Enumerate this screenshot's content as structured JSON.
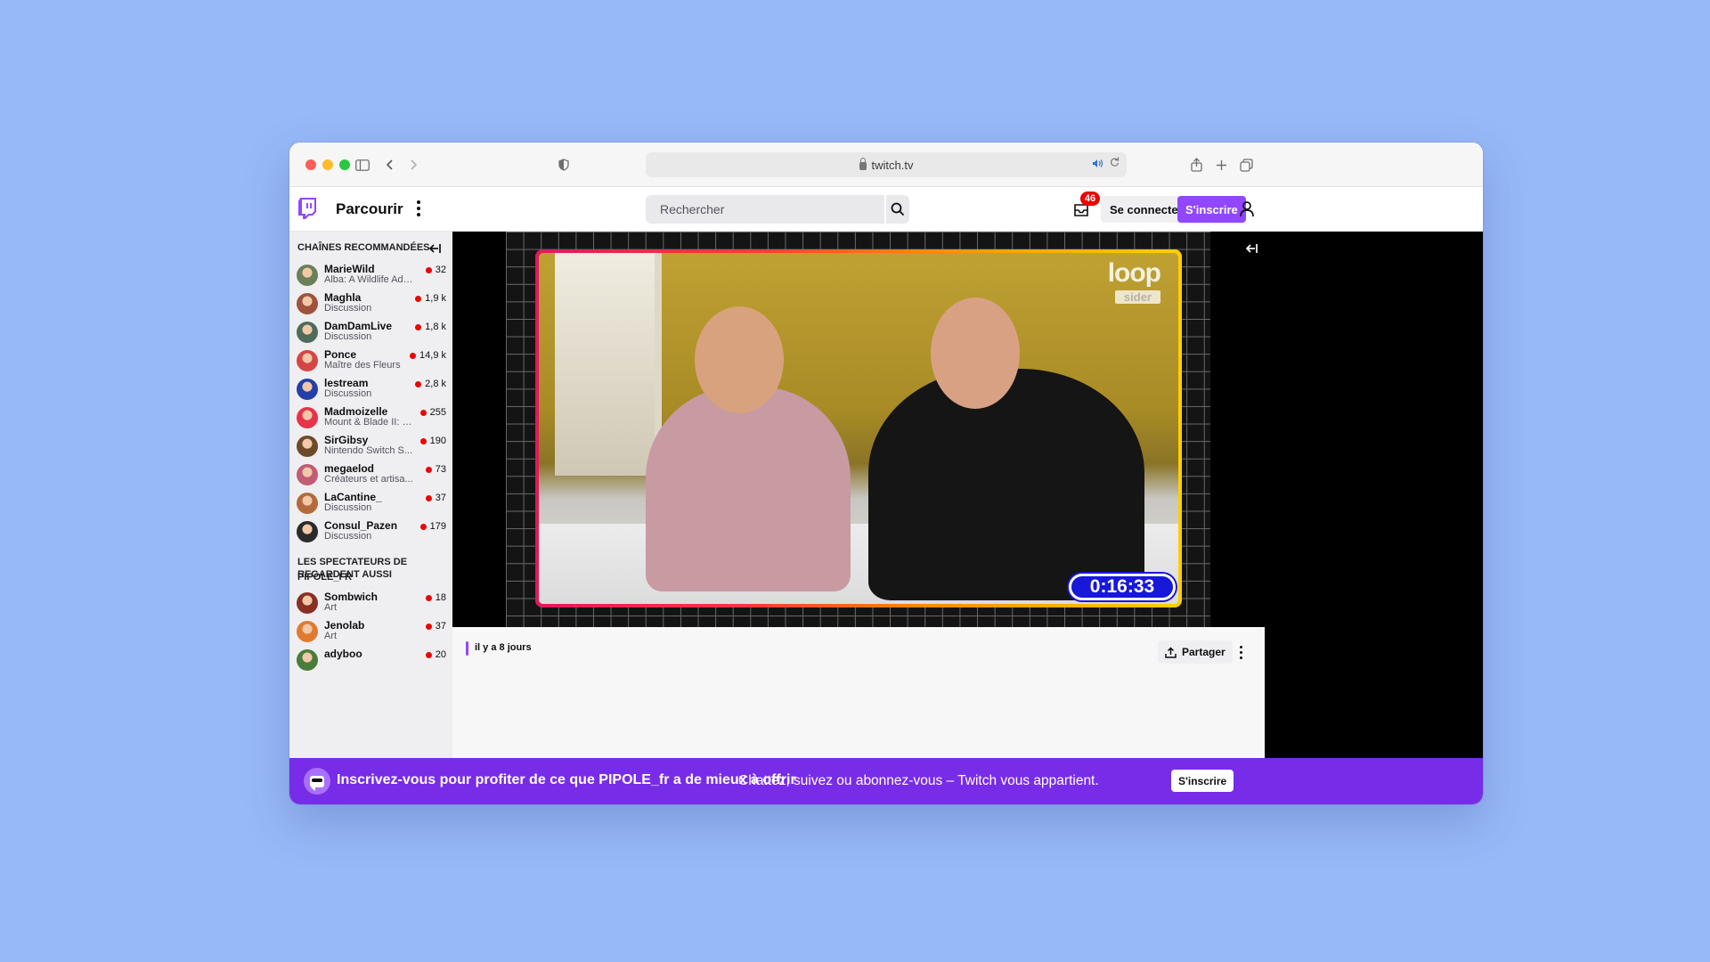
{
  "browser": {
    "url": "twitch.tv"
  },
  "nav": {
    "browse_label": "Parcourir",
    "search_placeholder": "Rechercher",
    "inbox_count": "46",
    "login_label": "Se connecter",
    "signup_label": "S'inscrire"
  },
  "sidebar": {
    "recommended_heading": "CHAÎNES RECOMMANDÉES",
    "recommended": [
      {
        "name": "MarieWild",
        "category": "Alba: A Wildlife Adv...",
        "viewers": "32",
        "color": "#6b7f5a"
      },
      {
        "name": "Maghla",
        "category": "Discussion",
        "viewers": "1,9 k",
        "color": "#a0523d"
      },
      {
        "name": "DamDamLive",
        "category": "Discussion",
        "viewers": "1,8 k",
        "color": "#4f6b5a"
      },
      {
        "name": "Ponce",
        "category": "Maître des Fleurs",
        "viewers": "14,9 k",
        "color": "#d64545"
      },
      {
        "name": "lestream",
        "category": "Discussion",
        "viewers": "2,8 k",
        "color": "#2440a8"
      },
      {
        "name": "Madmoizelle",
        "category": "Mount & Blade II: B...",
        "viewers": "255",
        "color": "#e8334a"
      },
      {
        "name": "SirGibsy",
        "category": "Nintendo Switch S...",
        "viewers": "190",
        "color": "#6d4b2a"
      },
      {
        "name": "megaelod",
        "category": "Créateurs et artisa...",
        "viewers": "73",
        "color": "#c25b74"
      },
      {
        "name": "LaCantine_",
        "category": "Discussion",
        "viewers": "37",
        "color": "#b36b3b"
      },
      {
        "name": "Consul_Pazen",
        "category": "Discussion",
        "viewers": "179",
        "color": "#2a2a2a"
      }
    ],
    "also_heading_1": "LES SPECTATEURS DE PIPOLE_FR",
    "also_heading_2": "REGARDENT AUSSI",
    "also": [
      {
        "name": "Sombwich",
        "category": "Art",
        "viewers": "18",
        "color": "#8a2f24"
      },
      {
        "name": "Jenolab",
        "category": "Art",
        "viewers": "37",
        "color": "#e07a2f"
      },
      {
        "name": "adyboo",
        "category": "",
        "viewers": "20",
        "color": "#4a7d3b"
      }
    ]
  },
  "player": {
    "overlay_logo": "loop",
    "overlay_sub": "sider",
    "timer": "0:16:33"
  },
  "meta": {
    "time_ago": "il y a 8 jours",
    "share_label": "Partager"
  },
  "banner": {
    "bold_text": "Inscrivez-vous pour profiter de ce que PIPOLE_fr a de mieux à offrir",
    "sub_text": "Chattez, suivez ou abonnez-vous – Twitch vous appartient.",
    "button_label": "S'inscrire"
  },
  "colors": {
    "brand": "#9147ff",
    "banner": "#772ce8",
    "live": "#eb0400",
    "page_bg": "#97b9f8"
  }
}
